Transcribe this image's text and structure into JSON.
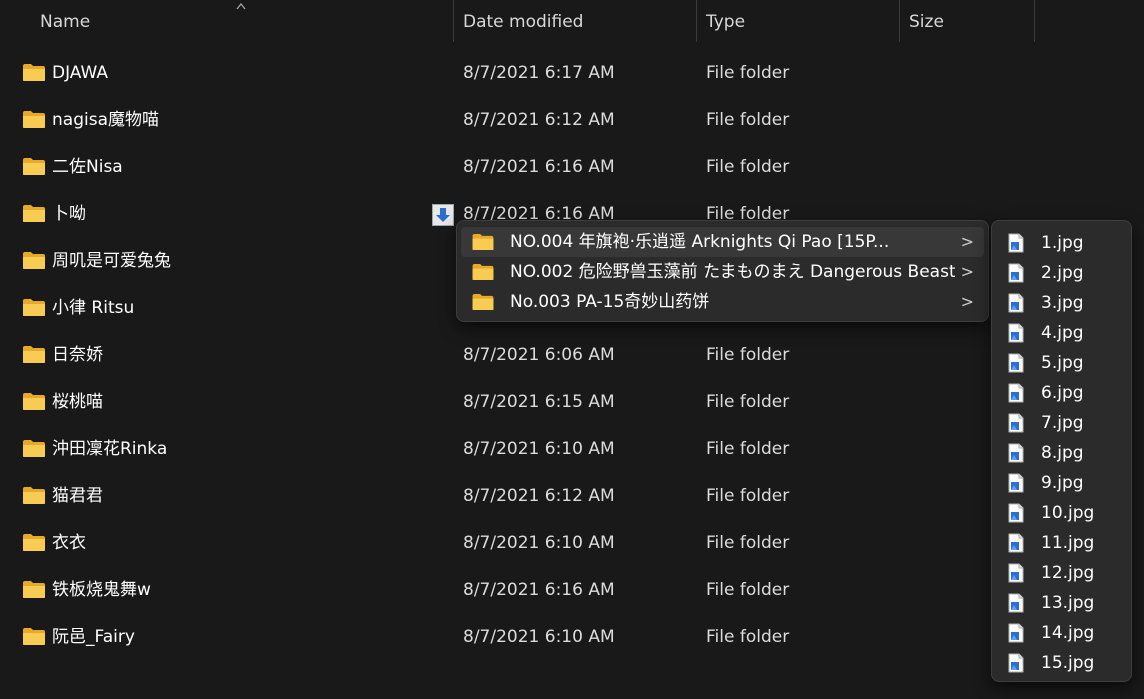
{
  "columns": {
    "name": "Name",
    "date_modified": "Date modified",
    "type": "Type",
    "size": "Size"
  },
  "rows": [
    {
      "name": "DJAWA",
      "date": "8/7/2021 6:17 AM",
      "type": "File folder"
    },
    {
      "name": "nagisa魔物喵",
      "date": "8/7/2021 6:12 AM",
      "type": "File folder"
    },
    {
      "name": "二佐Nisa",
      "date": "8/7/2021 6:16 AM",
      "type": "File folder"
    },
    {
      "name": "卜呦",
      "date": "8/7/2021 6:16 AM",
      "type": "File folder"
    },
    {
      "name": "周叽是可爱兔兔",
      "date": "",
      "type": ""
    },
    {
      "name": "小律 Ritsu",
      "date": "",
      "type": ""
    },
    {
      "name": "日奈娇",
      "date": "8/7/2021 6:06 AM",
      "type": "File folder"
    },
    {
      "name": "桜桃喵",
      "date": "8/7/2021 6:15 AM",
      "type": "File folder"
    },
    {
      "name": "沖田凜花Rinka",
      "date": "8/7/2021 6:10 AM",
      "type": "File folder"
    },
    {
      "name": "猫君君",
      "date": "8/7/2021 6:12 AM",
      "type": "File folder"
    },
    {
      "name": "衣衣",
      "date": "8/7/2021 6:10 AM",
      "type": "File folder"
    },
    {
      "name": "铁板烧鬼舞w",
      "date": "8/7/2021 6:16 AM",
      "type": "File folder"
    },
    {
      "name": "阮邑_Fairy",
      "date": "8/7/2021 6:10 AM",
      "type": "File folder"
    }
  ],
  "submenu": {
    "items": [
      {
        "label": "NO.004 年旗袍·乐逍遥 Arknights Qi Pao [15P...",
        "active": true
      },
      {
        "label": "NO.002 危险野兽玉藻前 たまものまえ Dangerous Beast...",
        "active": false
      },
      {
        "label": "No.003 PA-15奇妙山药饼",
        "active": false
      }
    ],
    "chevron": ">"
  },
  "files": [
    "1.jpg",
    "2.jpg",
    "3.jpg",
    "4.jpg",
    "5.jpg",
    "6.jpg",
    "7.jpg",
    "8.jpg",
    "9.jpg",
    "10.jpg",
    "11.jpg",
    "12.jpg",
    "13.jpg",
    "14.jpg",
    "15.jpg"
  ],
  "icons": {
    "folder": "folder-icon",
    "image_file": "image-file-icon",
    "download": "download-icon",
    "sort": "sort-ascending-icon"
  },
  "colors": {
    "background": "#191919",
    "menu_background": "#2b2b2b",
    "folder_yellow": "#f5c33b",
    "download_blue": "#2a6fd6"
  }
}
